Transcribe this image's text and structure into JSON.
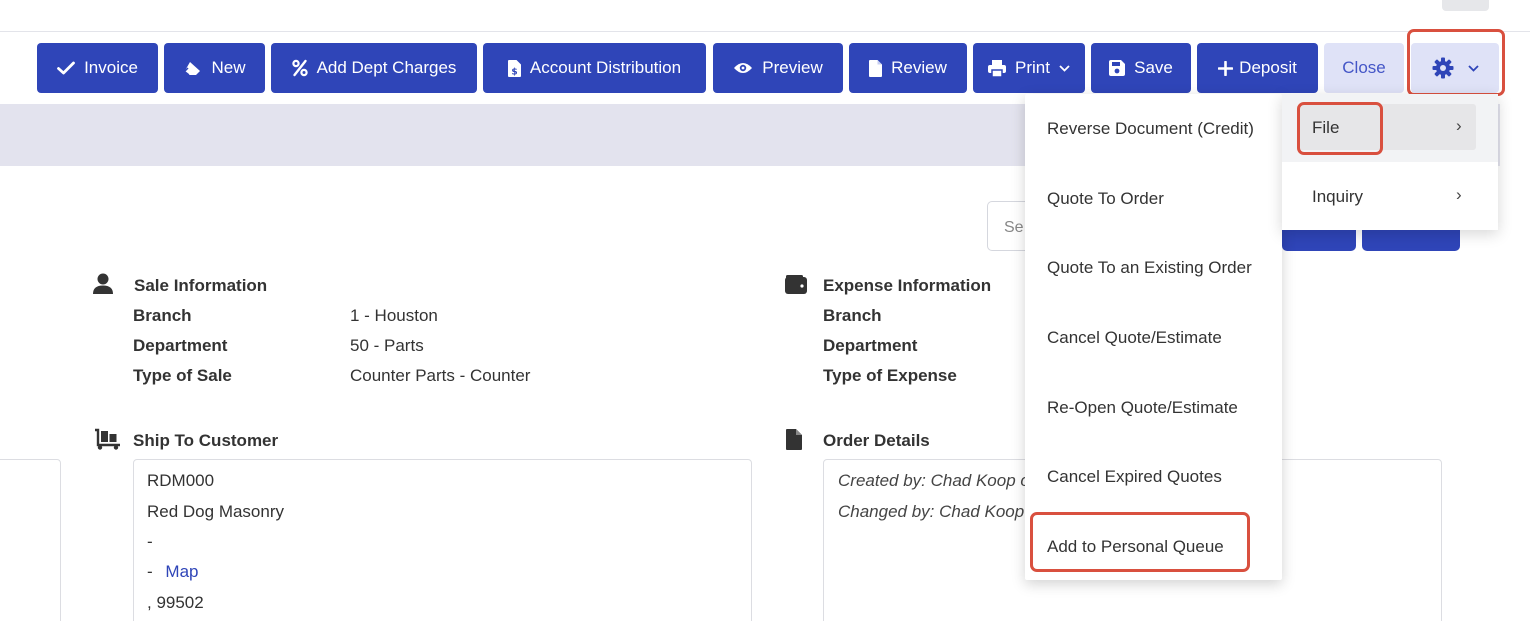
{
  "toolbar": {
    "buttons": [
      {
        "label": "Invoice",
        "icon": "check-icon"
      },
      {
        "label": "New",
        "icon": "eraser-icon"
      },
      {
        "label": "Add Dept Charges",
        "icon": "percent-icon"
      },
      {
        "label": "Account Distribution",
        "icon": "file-invoice-dollar-icon"
      },
      {
        "label": "Preview",
        "icon": "eye-icon"
      },
      {
        "label": "Review",
        "icon": "file-icon"
      },
      {
        "label": "Print",
        "icon": "printer-icon"
      },
      {
        "label": "Save",
        "icon": "floppy-disk-icon"
      },
      {
        "label": "Deposit",
        "icon": "plus-icon"
      },
      {
        "label": "Close"
      }
    ],
    "settings_icon": "gear-icon"
  },
  "search": {
    "placeholder_fragment": "Se"
  },
  "sale_information": {
    "title": "Sale Information",
    "icon": "user-icon",
    "rows": [
      {
        "label": "Branch",
        "value": "1 - Houston"
      },
      {
        "label": "Department",
        "value": "50 - Parts"
      },
      {
        "label": "Type of Sale",
        "value": "Counter Parts - Counter"
      }
    ]
  },
  "expense_information": {
    "title": "Expense Information",
    "icon": "wallet-icon",
    "rows": [
      {
        "label": "Branch"
      },
      {
        "label": "Department"
      },
      {
        "label": "Type of Expense"
      }
    ]
  },
  "ship_to_customer": {
    "title": "Ship To Customer",
    "icon": "dolly-icon",
    "code": "RDM000",
    "name": "Red Dog Masonry",
    "line3": "-",
    "line4_prefix": "-",
    "map_link": "Map",
    "line5": ", 99502"
  },
  "order_details": {
    "title": "Order Details",
    "icon": "file-icon",
    "created_by": "Created by: Chad Koop o",
    "changed_by": "Changed by: Chad Koop"
  },
  "dropdown_menu": {
    "items": [
      "Reverse Document (Credit)",
      "Quote To Order",
      "Quote To an Existing Order",
      "Cancel Quote/Estimate",
      "Re-Open Quote/Estimate",
      "Cancel Expired Quotes",
      "Add to Personal Queue"
    ]
  },
  "submenu": {
    "items": [
      {
        "label": "File",
        "chevron": "›"
      },
      {
        "label": "Inquiry",
        "chevron": "›"
      }
    ]
  },
  "colors": {
    "primary": "#2f45b8",
    "secondary_light": "#dfe2f7",
    "highlight": "#d9503f",
    "band": "#e3e3ee"
  }
}
